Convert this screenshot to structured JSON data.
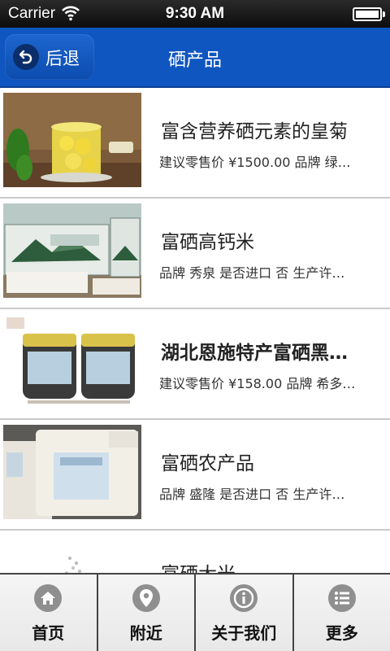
{
  "status_bar": {
    "carrier": "Carrier",
    "time": "9:30 AM",
    "battery_level": 1.0
  },
  "nav": {
    "back_label": "后退",
    "title": "硒产品",
    "color": "#0f56c0"
  },
  "items": [
    {
      "title": "富含营养硒元素的皇菊",
      "detail": "建议零售价 ¥1500.00 品牌 绿…",
      "title_bold": false,
      "image": "chrysanthemum-tea-photo"
    },
    {
      "title": "富硒高钙米",
      "detail": "品牌 秀泉 是否进口 否 生产许…",
      "title_bold": false,
      "image": "rice-gift-box-photo"
    },
    {
      "title": "湖北恩施特产富硒黑…",
      "detail": "建议零售价 ¥158.00 品牌 希多…",
      "title_bold": true,
      "image": "black-product-jars-photo"
    },
    {
      "title": "富硒农产品",
      "detail": "品牌 盛隆 是否进口 否 生产许…",
      "title_bold": false,
      "image": "rice-bags-photo"
    },
    {
      "title": "富硒大米",
      "detail": "",
      "title_bold": false,
      "image": "rice-photo"
    }
  ],
  "tabs": [
    {
      "label": "首页",
      "icon": "home-icon"
    },
    {
      "label": "附近",
      "icon": "location-pin-icon"
    },
    {
      "label": "关于我们",
      "icon": "info-icon"
    },
    {
      "label": "更多",
      "icon": "list-menu-icon"
    }
  ]
}
